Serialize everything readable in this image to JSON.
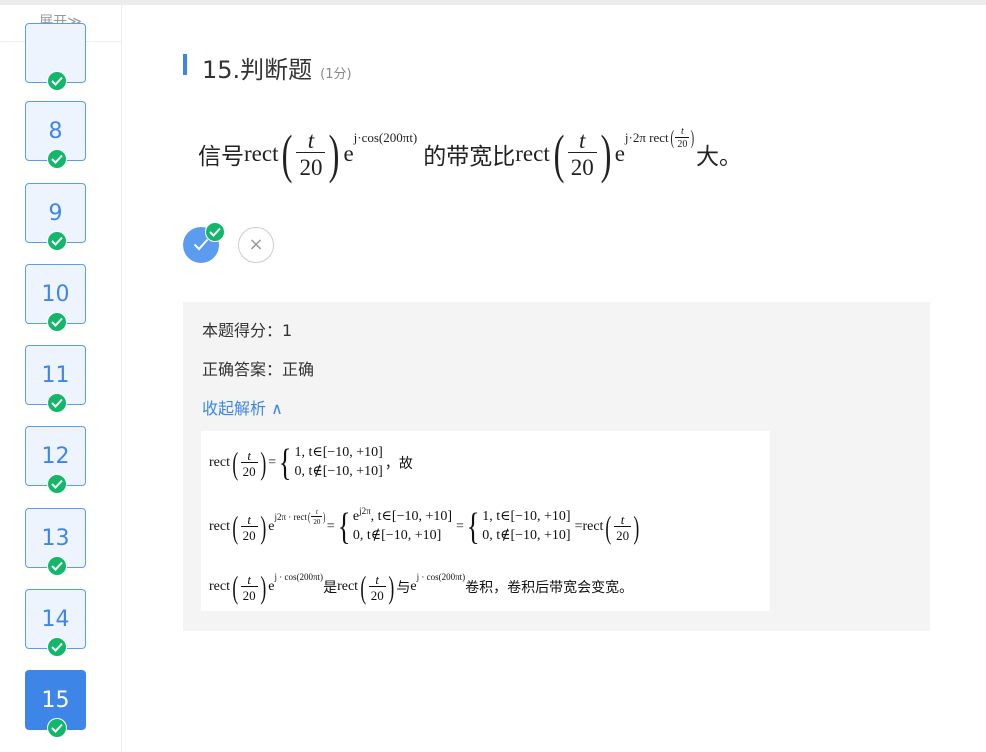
{
  "sidebar": {
    "expand_label": "展开≫",
    "items": [
      {
        "label": ""
      },
      {
        "label": "8"
      },
      {
        "label": "9"
      },
      {
        "label": "10"
      },
      {
        "label": "11"
      },
      {
        "label": "12"
      },
      {
        "label": "13"
      },
      {
        "label": "14"
      },
      {
        "label": "15"
      }
    ]
  },
  "question": {
    "title": "15.判断题",
    "score": "(1分)",
    "stem": {
      "prefix": "信号",
      "rect": "rect",
      "t": "t",
      "twenty": "20",
      "e": "e",
      "exp1": "j·cos(200πt)",
      "middle": "的带宽比",
      "exp2": "j·2π rect",
      "suffix": "大。"
    },
    "options": {
      "true_symbol": "✓",
      "false_symbol": "×"
    }
  },
  "answer": {
    "score_line": "本题得分：1",
    "correct_line": "正确答案：正确",
    "toggle_label": "收起解析 ∧"
  },
  "analysis": {
    "rect": "rect",
    "t": "t",
    "twenty": "20",
    "e": "e",
    "case1_top": "1,  t∈[−10, +10]",
    "case1_bottom": "0,  t∉[−10, +10]",
    "suffix1": "，故",
    "exp_row2": "j2π · rect",
    "case2_top": "e^{j2π},  t∈[−10, +10]",
    "case2_top_base": "e",
    "case2_top_exp": "j2π",
    "case2_top_rest": ",  t∈[−10, +10]",
    "case2_bottom": "0,      t∉[−10, +10]",
    "exp_row3": "j · cos(200πt)",
    "middle3": "是",
    "and3": "与",
    "end3": "卷积，卷积后带宽会变宽。"
  }
}
